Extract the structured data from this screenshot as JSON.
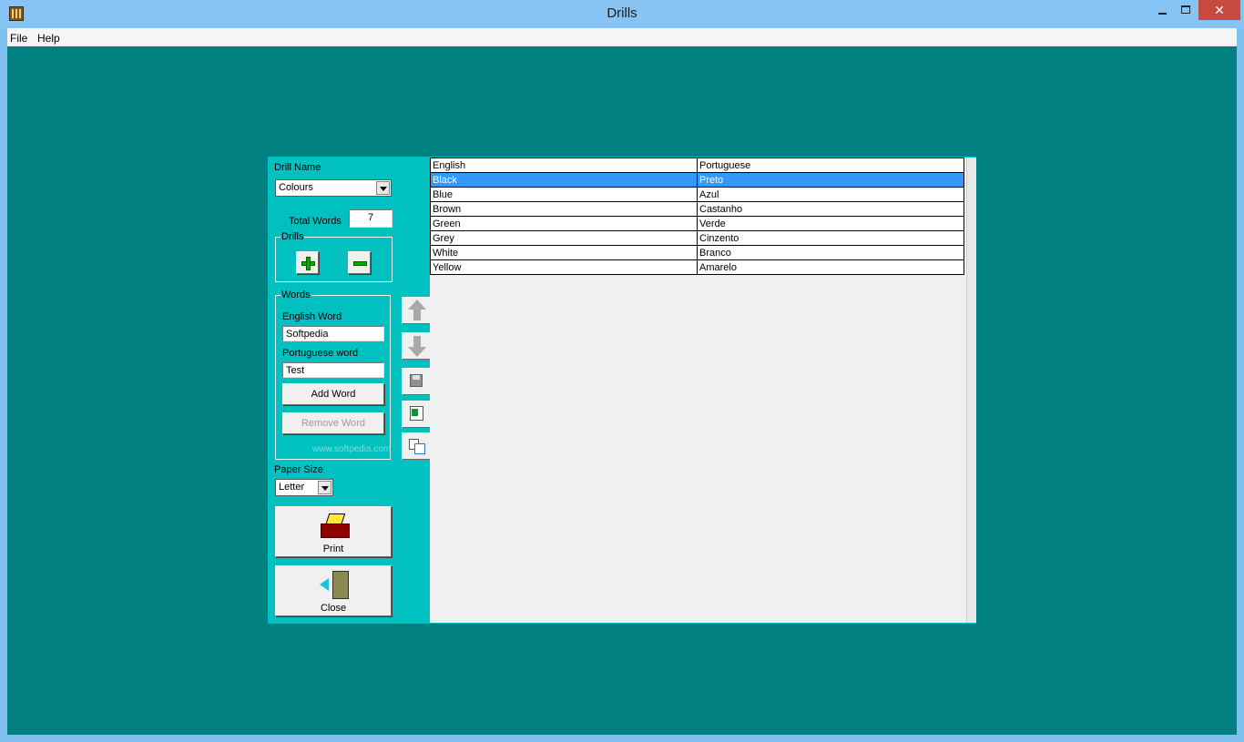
{
  "window": {
    "title": "Drills",
    "close_glyph": "✕"
  },
  "menu": {
    "file": "File",
    "help": "Help"
  },
  "form": {
    "drill_name_label": "Drill Name",
    "drill_name_value": "Colours",
    "total_words_label": "Total Words",
    "total_words_value": "7",
    "drills_group": "Drills",
    "words_group": "Words",
    "english_word_label": "English Word",
    "english_word_value": "Softpedia",
    "portuguese_word_label": "Portuguese word",
    "portuguese_word_value": "Test",
    "add_word_button": "Add Word",
    "remove_word_button": "Remove Word",
    "paper_size_label": "Paper Size",
    "paper_size_value": "Letter",
    "print_button": "Print",
    "close_button": "Close"
  },
  "watermark": "www.softpedia.com",
  "grid": {
    "columns": [
      "English",
      "Portuguese"
    ],
    "rows": [
      [
        "Black",
        "Preto"
      ],
      [
        "Blue",
        "Azul"
      ],
      [
        "Brown",
        "Castanho"
      ],
      [
        "Green",
        "Verde"
      ],
      [
        "Grey",
        "Cinzento"
      ],
      [
        "White",
        "Branco"
      ],
      [
        "Yellow",
        "Amarelo"
      ]
    ],
    "selected_row": 0
  },
  "colors": {
    "desktop": "#008080",
    "dialog": "#00c0c0",
    "selection": "#3399ff",
    "titlebar": "#88c4f3"
  }
}
